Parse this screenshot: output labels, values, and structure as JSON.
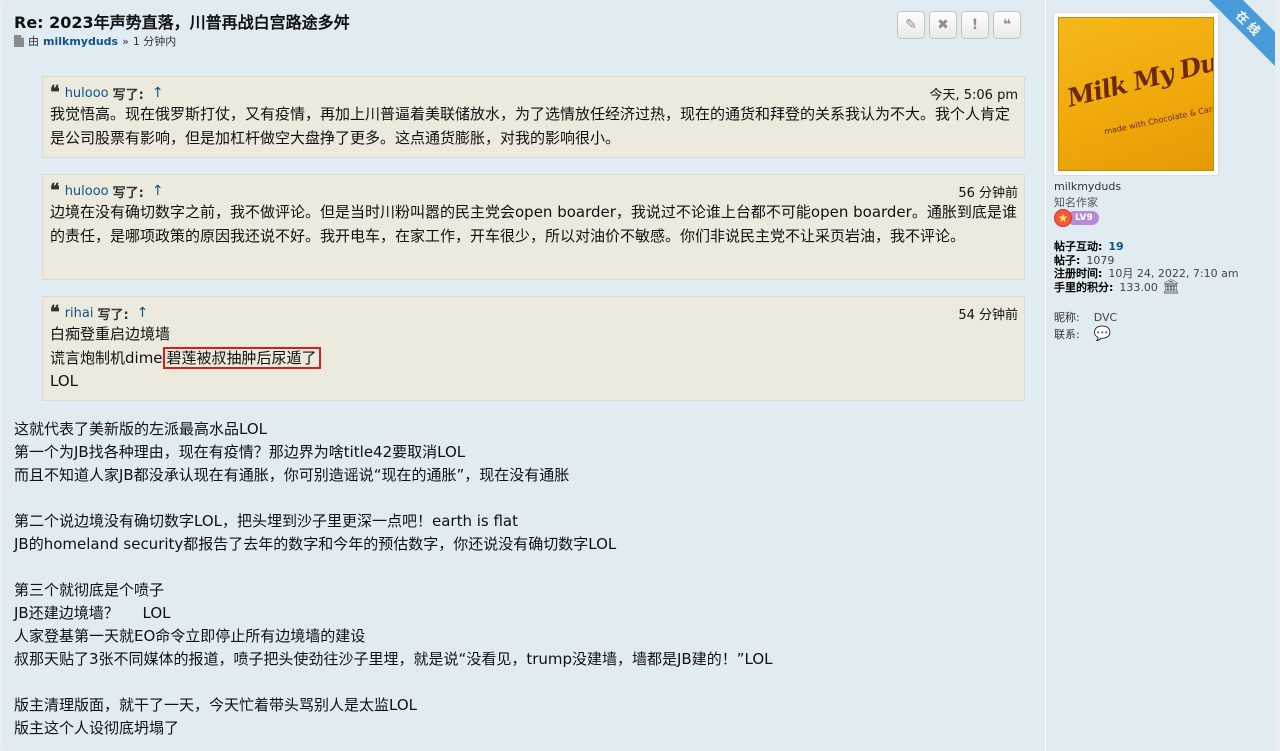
{
  "post": {
    "title": "Re: 2023年声势直落，川普再战白宫路途多舛",
    "by": "由",
    "author": "milkmyduds",
    "sep": "»",
    "time": "1 分钟内"
  },
  "buttons": [
    {
      "name": "edit-button",
      "icon": "pencil-icon",
      "glyph": "✎"
    },
    {
      "name": "delete-button",
      "icon": "close-icon",
      "glyph": "✖"
    },
    {
      "name": "report-button",
      "icon": "warning-icon",
      "glyph": "!"
    },
    {
      "name": "quote-button",
      "icon": "quote-icon",
      "glyph": "❝"
    }
  ],
  "quotes": [
    {
      "user": "hulooo",
      "said": "写了:",
      "arrow": "↑",
      "time": "今天, 5:06 pm",
      "lines": [
        "我觉悟高。现在俄罗斯打仗，又有疫情，再加上川普逼着美联储放水，为了选情放任经济过热，现在的通货和拜登的关系我认为不大。我个人肯定是公司股票有影响，但是加杠杆做空大盘挣了更多。这点通货膨胀，对我的影响很小。"
      ]
    },
    {
      "user": "hulooo",
      "said": "写了:",
      "arrow": "↑",
      "time": "56 分钟前",
      "lines": [
        "边境在没有确切数字之前，我不做评论。但是当时川粉叫嚣的民主党会open boarder，我说过不论谁上台都不可能open boarder。通胀到底是谁的责任，是哪项政策的原因我还说不好。我开电车，在家工作，开车很少，所以对油价不敏感。你们非说民主党不让采页岩油，我不评论。"
      ]
    },
    {
      "user": "rihai",
      "said": "写了:",
      "arrow": "↑",
      "time": "54 分钟前",
      "line1": "白痴登重启边境墙",
      "line2_pre": "谎言炮制机dime",
      "line2_highlight": "碧莲被叔抽肿后尿遁了",
      "line3": "LOL"
    }
  ],
  "body_lines": [
    "这就代表了美新版的左派最高水品LOL",
    "第一个为JB找各种理由，现在有疫情？那边界为啥title42要取消LOL",
    "而且不知道人家JB都没承认现在有通胀，你可别造谣说“现在的通胀”，现在没有通胀",
    "",
    "第二个说边境没有确切数字LOL，把头埋到沙子里更深一点吧！earth is flat",
    "JB的homeland security都报告了去年的数字和今年的预估数字，你还说没有确切数字LOL",
    "",
    "第三个就彻底是个喷子",
    "JB还建边境墙？     LOL",
    "人家登基第一天就EO命令立即停止所有边境墙的建设",
    "叔那天贴了3张不同媒体的报道，喷子把头使劲往沙子里埋，就是说“没看见，trump没建墙，墙都是JB建的！”LOL",
    "",
    "版主清理版面，就干了一天，今天忙着带头骂别人是太监LOL",
    "版主这个人设彻底坍塌了"
  ],
  "profile": {
    "online_ribbon": "在线",
    "avatar_brand": "Milk My Duds",
    "avatar_sub": "made with Chocolate & Caramel",
    "username": "milkmyduds",
    "rank": "知名作家",
    "level": "LV9",
    "stats": [
      {
        "label": "帖子互动:",
        "value": "19",
        "link": true
      },
      {
        "label": "帖子:",
        "value": "1079",
        "link": false
      },
      {
        "label": "注册时间:",
        "value": "10月 24, 2022, 7:10 am",
        "link": false
      },
      {
        "label": "手里的积分:",
        "value": "133.00",
        "link": false,
        "icon": "bank-icon"
      }
    ],
    "nickname_label": "昵称:",
    "nickname": "DVC",
    "contact_label": "联系:",
    "contact_icon": "chat-icon"
  },
  "colors": {
    "post_bg": "#e1ebf2",
    "quote_bg": "#ebeadd",
    "link": "#105289",
    "highlight_border": "#d91c1c",
    "ribbon": "#4a9bd9"
  }
}
